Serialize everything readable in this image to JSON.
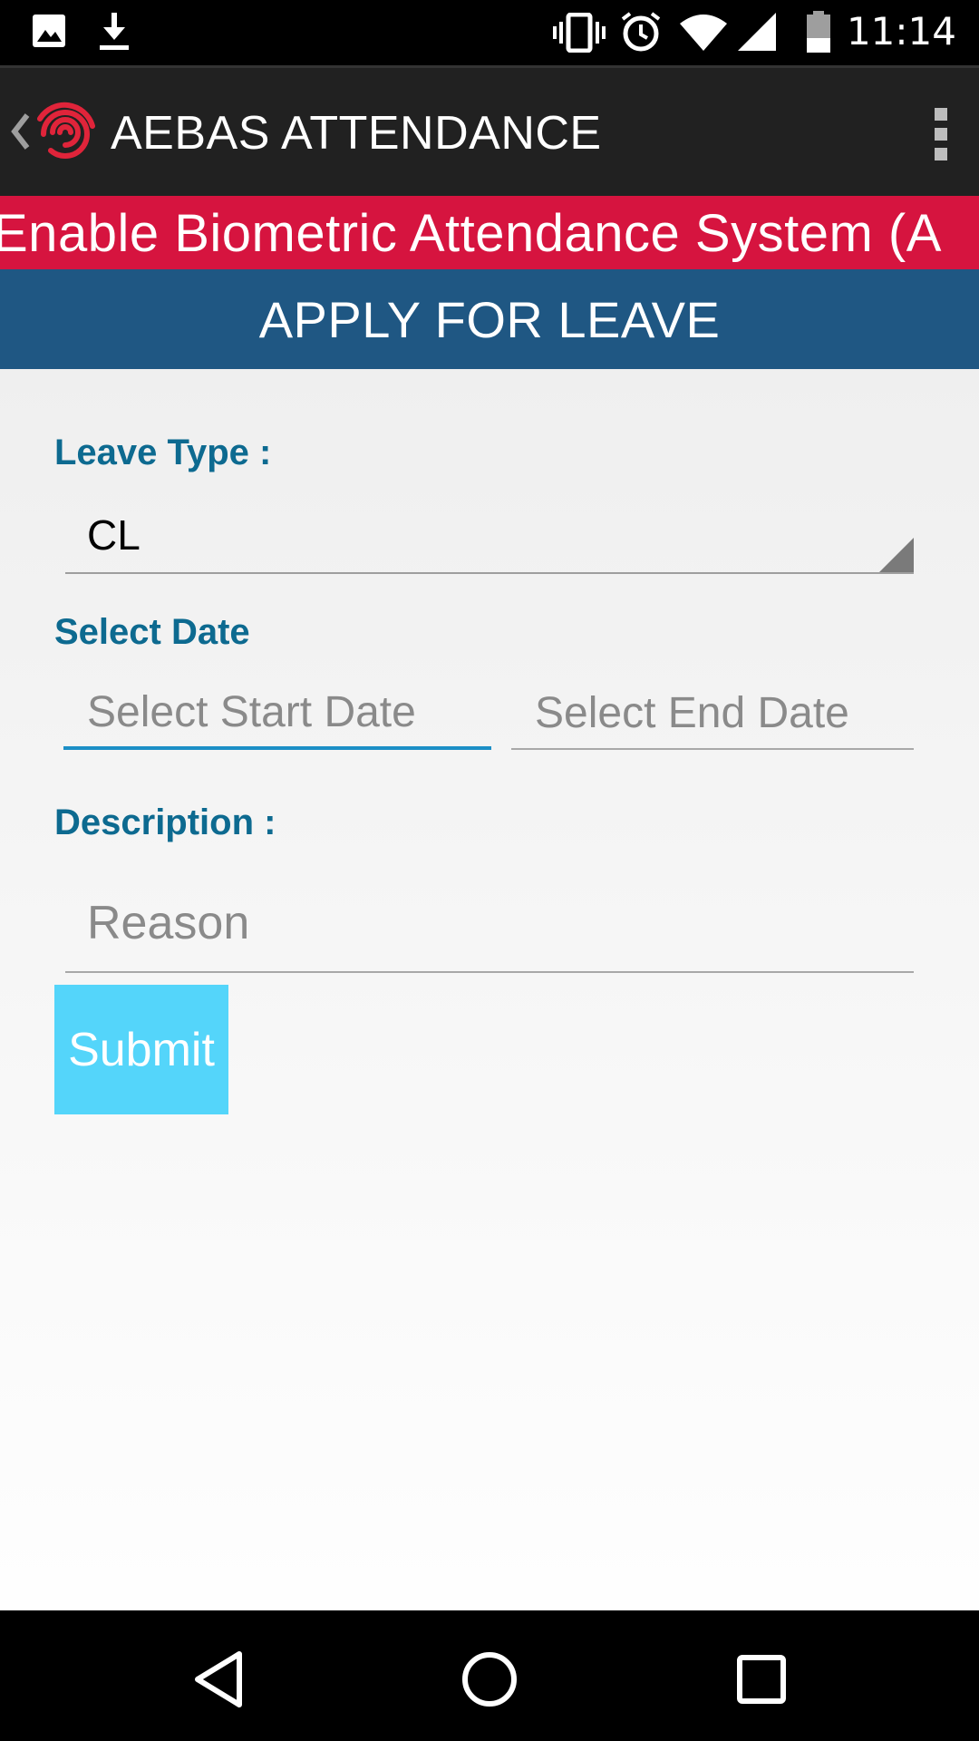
{
  "status_bar": {
    "time": "11:14",
    "icons": [
      "image-icon",
      "download-icon",
      "vibrate-icon",
      "alarm-icon",
      "wifi-icon",
      "signal-icon",
      "battery-icon"
    ]
  },
  "app_bar": {
    "title": "AEBAS ATTENDANCE",
    "icons": [
      "back-chevron-icon",
      "fingerprint-logo-icon",
      "overflow-menu-icon"
    ]
  },
  "marquee": {
    "text": "Enable Biometric Attendance System (A"
  },
  "page": {
    "title": "APPLY FOR LEAVE"
  },
  "form": {
    "leave_type_label": "Leave Type :",
    "leave_type_value": "CL",
    "select_date_label": "Select Date",
    "start_date_placeholder": "Select Start Date",
    "end_date_placeholder": "Select End Date",
    "description_label": "Description :",
    "reason_placeholder": "Reason",
    "submit_label": "Submit"
  },
  "colors": {
    "marquee_bg": "#d6143f",
    "header_bg": "#1f5783",
    "label_color": "#0d6a90",
    "submit_bg": "#54d5fa",
    "focus_underline": "#1c8fc6"
  }
}
